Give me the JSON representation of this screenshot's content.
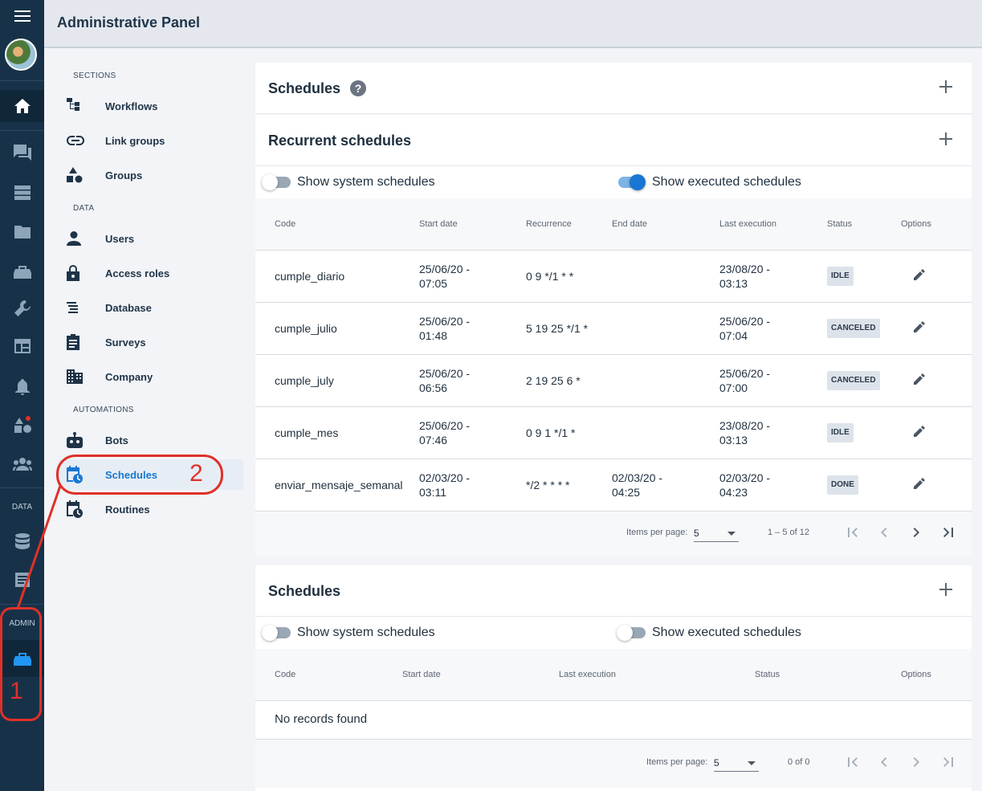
{
  "header": {
    "title": "Administrative Panel"
  },
  "rail": {
    "data_label": "DATA",
    "admin_label": "ADMIN"
  },
  "nav": {
    "sections_label": "SECTIONS",
    "data_label": "DATA",
    "automations_label": "AUTOMATIONS",
    "items": [
      {
        "label": "Workflows",
        "icon": "workflow-icon"
      },
      {
        "label": "Link groups",
        "icon": "link-icon"
      },
      {
        "label": "Groups",
        "icon": "shapes-icon"
      },
      {
        "label": "Users",
        "icon": "user-icon"
      },
      {
        "label": "Access roles",
        "icon": "lock-icon"
      },
      {
        "label": "Database",
        "icon": "database-icon"
      },
      {
        "label": "Surveys",
        "icon": "clipboard-icon"
      },
      {
        "label": "Company",
        "icon": "building-icon"
      },
      {
        "label": "Bots",
        "icon": "robot-icon"
      },
      {
        "label": "Schedules",
        "icon": "calendar-clock-icon",
        "active": true
      },
      {
        "label": "Routines",
        "icon": "calendar-clock-icon"
      }
    ]
  },
  "schedules_header": {
    "title": "Schedules"
  },
  "recurrent": {
    "title": "Recurrent schedules",
    "show_system": "Show system schedules",
    "show_system_on": false,
    "show_executed": "Show executed schedules",
    "show_executed_on": true,
    "columns": [
      "Code",
      "Start date",
      "Recurrence",
      "End date",
      "Last execution",
      "Status",
      "Options"
    ],
    "rows": [
      {
        "code": "cumple_diario",
        "start": "25/06/20 - 07:05",
        "rec": "0 9 */1 * *",
        "end": "",
        "last": "23/08/20 - 03:13",
        "status": "IDLE"
      },
      {
        "code": "cumple_julio",
        "start": "25/06/20 - 01:48",
        "rec": "5 19 25 */1 *",
        "end": "",
        "last": "25/06/20 - 07:04",
        "status": "CANCELED"
      },
      {
        "code": "cumple_july",
        "start": "25/06/20 - 06:56",
        "rec": "2 19 25 6 *",
        "end": "",
        "last": "25/06/20 - 07:00",
        "status": "CANCELED"
      },
      {
        "code": "cumple_mes",
        "start": "25/06/20 - 07:46",
        "rec": "0 9 1 */1 *",
        "end": "",
        "last": "23/08/20 - 03:13",
        "status": "IDLE"
      },
      {
        "code": "enviar_mensaje_semanal",
        "start": "02/03/20 - 03:11",
        "rec": "*/2 * * * *",
        "end": "02/03/20 - 04:25",
        "last": "02/03/20 - 04:23",
        "status": "DONE"
      }
    ],
    "pager": {
      "items_per_page": "Items per page:",
      "size": "5",
      "range": "1 – 5 of 12"
    }
  },
  "single": {
    "title": "Schedules",
    "show_system": "Show system schedules",
    "show_system_on": false,
    "show_executed": "Show executed schedules",
    "show_executed_on": false,
    "columns": [
      "Code",
      "Start date",
      "Last execution",
      "Status",
      "Options"
    ],
    "empty": "No records found",
    "pager": {
      "items_per_page": "Items per page:",
      "size": "5",
      "range": "0 of 0"
    }
  },
  "annotations": {
    "one": "1",
    "two": "2"
  },
  "colors": {
    "rail": "#173248",
    "accent": "#1976d2",
    "annotation": "#e0302a"
  }
}
